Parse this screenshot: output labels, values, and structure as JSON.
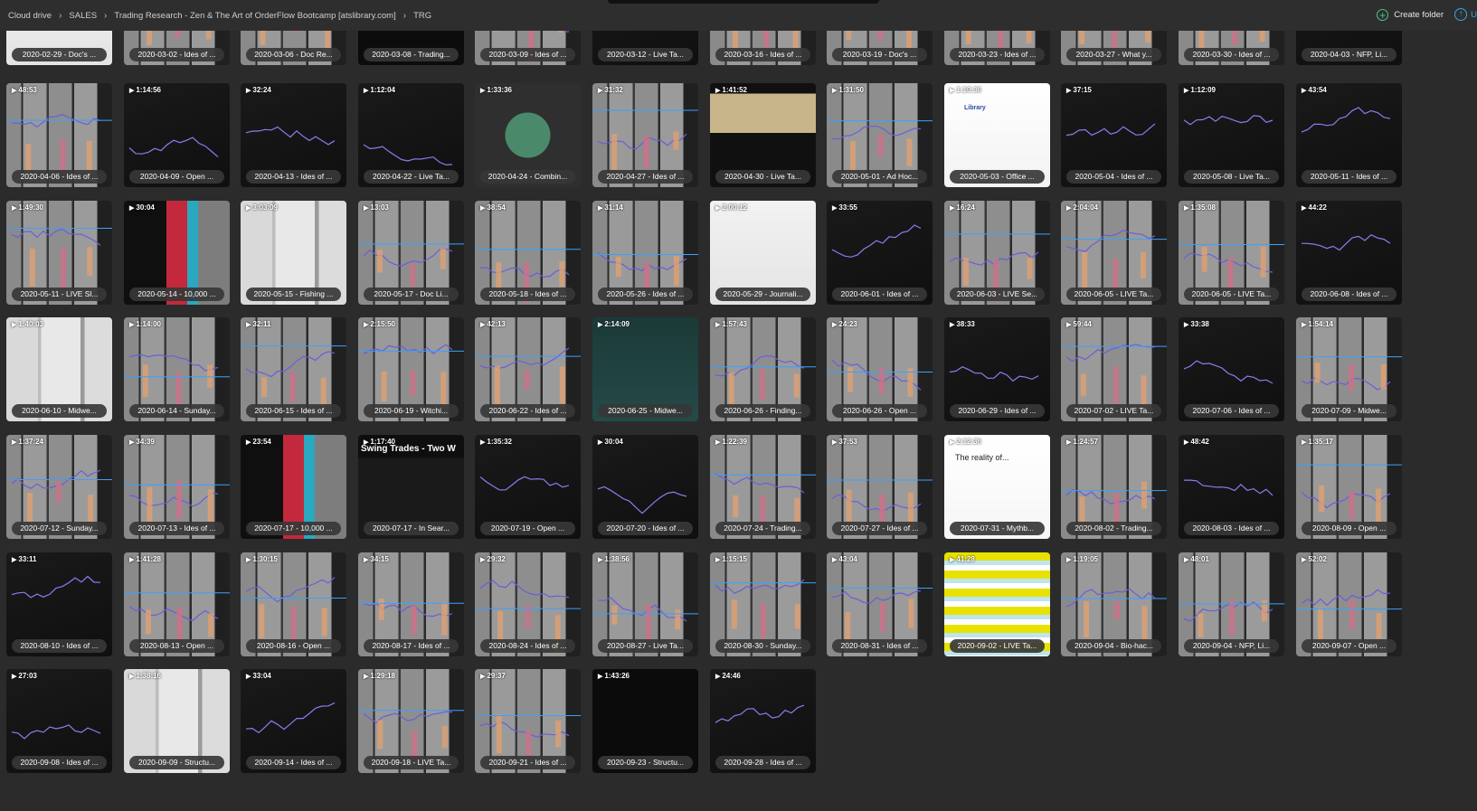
{
  "breadcrumb": [
    "Cloud drive",
    "SALES",
    "Trading Research - Zen & The Art of OrderFlow Bootcamp [atslibrary.com]",
    "TRG"
  ],
  "actions": {
    "create_folder": "Create folder",
    "upload": "U"
  },
  "colors": {
    "accent_green": "#4ec08a",
    "accent_blue": "#3aa6e0",
    "background": "#2b2b2c"
  },
  "rows": [
    {
      "partial": true,
      "items": [
        {
          "title": "2020-02-29 - Doc's ...",
          "duration": "",
          "theme": "white"
        },
        {
          "title": "2020-03-02 - Ides of ...",
          "duration": "",
          "theme": "grey"
        },
        {
          "title": "2020-03-06 - Doc Re...",
          "duration": "",
          "theme": "grey"
        },
        {
          "title": "2020-03-08 - Trading...",
          "duration": "",
          "theme": "green"
        },
        {
          "title": "2020-03-09 - Ides of ...",
          "duration": "",
          "theme": "grey"
        },
        {
          "title": "2020-03-12 - Live Ta...",
          "duration": "",
          "theme": "dark"
        },
        {
          "title": "2020-03-16 - Ides of ...",
          "duration": "",
          "theme": "grey"
        },
        {
          "title": "2020-03-19 - Doc's ...",
          "duration": "",
          "theme": "grey"
        },
        {
          "title": "2020-03-23 - Ides of ...",
          "duration": "",
          "theme": "grey"
        },
        {
          "title": "2020-03-27 - What y...",
          "duration": "",
          "theme": "grey"
        },
        {
          "title": "2020-03-30 - Ides of ...",
          "duration": "",
          "theme": "grey"
        },
        {
          "title": "2020-04-03 - NFP, Li...",
          "duration": "",
          "theme": "dark"
        }
      ]
    },
    {
      "items": [
        {
          "title": "2020-04-06 - Ides of ...",
          "duration": "48:53",
          "theme": "grey"
        },
        {
          "title": "2020-04-09 - Open ...",
          "duration": "1:14:56",
          "theme": "dark"
        },
        {
          "title": "2020-04-13 - Ides of ...",
          "duration": "32:24",
          "theme": "dark"
        },
        {
          "title": "2020-04-22 - Live Ta...",
          "duration": "1:12:04",
          "theme": "dark"
        },
        {
          "title": "2020-04-24 - Combin...",
          "duration": "1:33:36",
          "theme": "slide"
        },
        {
          "title": "2020-04-27 - Ides of ...",
          "duration": "31:32",
          "theme": "grey"
        },
        {
          "title": "2020-04-30 - Live Ta...",
          "duration": "1:41:52",
          "theme": "table"
        },
        {
          "title": "2020-05-01 - Ad Hoc...",
          "duration": "1:31:50",
          "theme": "grey"
        },
        {
          "title": "2020-05-03 - Office ...",
          "duration": "1:10:36",
          "theme": "library"
        },
        {
          "title": "2020-05-04 - Ides of ...",
          "duration": "37:15",
          "theme": "dark"
        },
        {
          "title": "2020-05-08 - Live Ta...",
          "duration": "1:12:09",
          "theme": "dark"
        },
        {
          "title": "2020-05-11 - Ides of ...",
          "duration": "43:54",
          "theme": "dark"
        }
      ]
    },
    {
      "items": [
        {
          "title": "2020-05-11 - LIVE Sl...",
          "duration": "1:49:30",
          "theme": "grey"
        },
        {
          "title": "2020-05-14 - 10,000 ...",
          "duration": "30:04",
          "theme": "redcyan"
        },
        {
          "title": "2020-05-15 - Fishing ...",
          "duration": "3:03:09",
          "theme": "light"
        },
        {
          "title": "2020-05-17 - Doc Li...",
          "duration": "13:03",
          "theme": "grey"
        },
        {
          "title": "2020-05-18 - Ides of ...",
          "duration": "38:54",
          "theme": "grey"
        },
        {
          "title": "2020-05-26 - Ides of ...",
          "duration": "31:14",
          "theme": "grey"
        },
        {
          "title": "2020-05-29 - Journali...",
          "duration": "2:00:12",
          "theme": "white"
        },
        {
          "title": "2020-06-01 - Ides of ...",
          "duration": "33:55",
          "theme": "dark"
        },
        {
          "title": "2020-06-03 - LIVE Se...",
          "duration": "16:24",
          "theme": "grey"
        },
        {
          "title": "2020-06-05 - LIVE Ta...",
          "duration": "2:04:04",
          "theme": "grey"
        },
        {
          "title": "2020-06-05 - LIVE Ta...",
          "duration": "1:35:08",
          "theme": "grey"
        },
        {
          "title": "2020-06-08 - Ides of ...",
          "duration": "44:22",
          "theme": "dark"
        }
      ]
    },
    {
      "items": [
        {
          "title": "2020-06-10 - Midwe...",
          "duration": "1:40:03",
          "theme": "light"
        },
        {
          "title": "2020-06-14 - Sunday...",
          "duration": "1:14:00",
          "theme": "grey"
        },
        {
          "title": "2020-06-15 - Ides of ...",
          "duration": "32:11",
          "theme": "grey"
        },
        {
          "title": "2020-06-19 - Witchi...",
          "duration": "2:15:50",
          "theme": "grey"
        },
        {
          "title": "2020-06-22 - Ides of ...",
          "duration": "42:13",
          "theme": "grey"
        },
        {
          "title": "2020-06-25 - Midwe...",
          "duration": "2:14:09",
          "theme": "teal"
        },
        {
          "title": "2020-06-26 - Finding...",
          "duration": "1:57:43",
          "theme": "grey"
        },
        {
          "title": "2020-06-26 - Open ...",
          "duration": "24:23",
          "theme": "grey"
        },
        {
          "title": "2020-06-29 - Ides of ...",
          "duration": "38:33",
          "theme": "dark"
        },
        {
          "title": "2020-07-02 - LIVE Ta...",
          "duration": "59:44",
          "theme": "grey"
        },
        {
          "title": "2020-07-06 - Ides of ...",
          "duration": "33:38",
          "theme": "dark"
        },
        {
          "title": "2020-07-09 - Midwe...",
          "duration": "1:54:14",
          "theme": "grey"
        }
      ]
    },
    {
      "items": [
        {
          "title": "2020-07-12 - Sunday...",
          "duration": "1:37:24",
          "theme": "grey"
        },
        {
          "title": "2020-07-13 - Ides of ...",
          "duration": "34:39",
          "theme": "grey"
        },
        {
          "title": "2020-07-17 - 10,000 ...",
          "duration": "23:54",
          "theme": "redcyan"
        },
        {
          "title": "2020-07-17 - In Sear...",
          "duration": "1:17:40",
          "theme": "swing"
        },
        {
          "title": "2020-07-19 - Open ...",
          "duration": "1:35:32",
          "theme": "dark"
        },
        {
          "title": "2020-07-20 - Ides of ...",
          "duration": "30:04",
          "theme": "dark"
        },
        {
          "title": "2020-07-24 - Trading...",
          "duration": "1:22:39",
          "theme": "grey"
        },
        {
          "title": "2020-07-27 - Ides of ...",
          "duration": "37:53",
          "theme": "grey"
        },
        {
          "title": "2020-07-31 - Mythb...",
          "duration": "2:12:36",
          "theme": "reality"
        },
        {
          "title": "2020-08-02 - Trading...",
          "duration": "1:24:57",
          "theme": "grey"
        },
        {
          "title": "2020-08-03 - Ides of ...",
          "duration": "48:42",
          "theme": "dark"
        },
        {
          "title": "2020-08-09 - Open ...",
          "duration": "1:35:17",
          "theme": "grey"
        }
      ]
    },
    {
      "items": [
        {
          "title": "2020-08-10 - Ides of ...",
          "duration": "33:11",
          "theme": "dark"
        },
        {
          "title": "2020-08-13 - Open ...",
          "duration": "1:41:28",
          "theme": "grey"
        },
        {
          "title": "2020-08-16 - Open ...",
          "duration": "1:30:15",
          "theme": "grey"
        },
        {
          "title": "2020-08-17 - Ides of ...",
          "duration": "34:15",
          "theme": "grey"
        },
        {
          "title": "2020-08-24 - Ides of ...",
          "duration": "29:32",
          "theme": "grey"
        },
        {
          "title": "2020-08-27 - Live Ta...",
          "duration": "1:38:56",
          "theme": "grey"
        },
        {
          "title": "2020-08-30 - Sunday...",
          "duration": "1:15:15",
          "theme": "grey"
        },
        {
          "title": "2020-08-31 - Ides of ...",
          "duration": "43:04",
          "theme": "grey"
        },
        {
          "title": "2020-09-02 - LIVE Ta...",
          "duration": "41:28",
          "theme": "yellow"
        },
        {
          "title": "2020-09-04 - Bio-hac...",
          "duration": "1:19:05",
          "theme": "grey"
        },
        {
          "title": "2020-09-04 - NFP, Li...",
          "duration": "48:01",
          "theme": "grey"
        },
        {
          "title": "2020-09-07 - Open ...",
          "duration": "52:02",
          "theme": "grey"
        }
      ]
    },
    {
      "items": [
        {
          "title": "2020-09-08 - Ides of ...",
          "duration": "27:03",
          "theme": "dark"
        },
        {
          "title": "2020-09-09 - Structu...",
          "duration": "1:38:16",
          "theme": "light"
        },
        {
          "title": "2020-09-14 - Ides of ...",
          "duration": "33:04",
          "theme": "dark"
        },
        {
          "title": "2020-09-18 - LIVE Ta...",
          "duration": "1:29:18",
          "theme": "grey"
        },
        {
          "title": "2020-09-21 - Ides of ...",
          "duration": "29:37",
          "theme": "grey"
        },
        {
          "title": "2020-09-23 - Structu...",
          "duration": "1:43:26",
          "theme": "black"
        },
        {
          "title": "2020-09-28 - Ides of ...",
          "duration": "24:46",
          "theme": "dark"
        }
      ]
    }
  ],
  "thumb_text": {
    "swing": "Swing Trades - Two W",
    "reality": "The reality of...",
    "library": "Library"
  }
}
